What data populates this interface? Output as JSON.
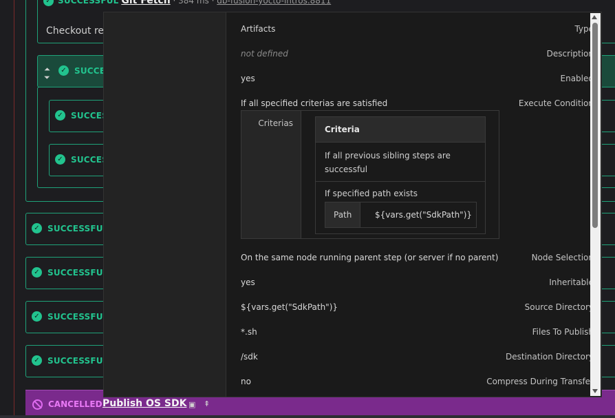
{
  "background": {
    "top_status": "SUCCESSFUL",
    "top_link": "Git Fetch",
    "top_meta": "· 384 ms ·",
    "top_branch": "db-fusion-yocto-intros.8811",
    "checkout_text": "Checkout re",
    "group_status": "SUCCE",
    "nested_status_1": "SUCCES",
    "nested_status_2": "SUCCES",
    "steps": [
      "SUCCESSFUL",
      "SUCCESSFUL",
      "SUCCESSFUL",
      "SUCCESSFUL"
    ],
    "cancel_status": "CANCELLED",
    "cancel_link": "Publish OS SDK",
    "colors": {
      "success": "#22c38e",
      "cancelled": "#7a2a8c"
    }
  },
  "popover": {
    "rows": [
      {
        "label": "Type",
        "value": "Artifacts"
      },
      {
        "label": "Description",
        "value": "not defined"
      },
      {
        "label": "Enabled",
        "value": "yes"
      },
      {
        "label": "Execute Condition",
        "value": "If all specified criterias are satisfied"
      },
      {
        "label": "Node Selection",
        "value": "On the same node running parent step (or server if no parent)"
      },
      {
        "label": "Inheritable",
        "value": "yes"
      },
      {
        "label": "Source Directory",
        "value": "${vars.get(\"SdkPath\")}"
      },
      {
        "label": "Files To Publish",
        "value": "*.sh"
      },
      {
        "label": "Destination Directory",
        "value": "/sdk"
      },
      {
        "label": "Compress During Transfer",
        "value": "no"
      }
    ],
    "condition": {
      "label": "Criterias",
      "header": "Criteria",
      "criteria_1": "If all previous sibling steps are successful",
      "criteria_2": "If specified path exists",
      "path_key": "Path",
      "path_value": "${vars.get(\"SdkPath\")}"
    }
  }
}
